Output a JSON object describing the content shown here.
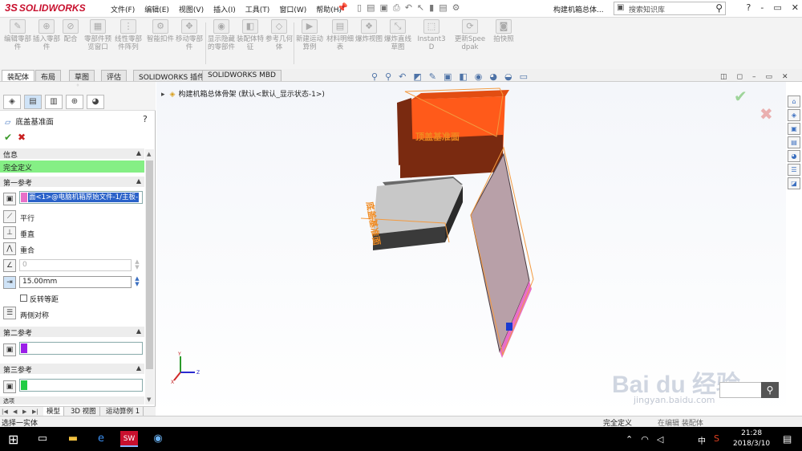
{
  "app": {
    "logo_ds": "3S",
    "logo_text": "SOLIDWORKS",
    "document_title": "构建机箱总体...",
    "search_placeholder": "搜索知识库"
  },
  "menu": [
    "文件(F)",
    "编辑(E)",
    "视图(V)",
    "插入(I)",
    "工具(T)",
    "窗口(W)",
    "帮助(H)"
  ],
  "window_controls": [
    "?",
    "-",
    "▭",
    "✕"
  ],
  "commands": [
    {
      "label": "编辑零部件"
    },
    {
      "label": "插入零部件"
    },
    {
      "label": "配合"
    },
    {
      "label": "零部件预览窗口"
    },
    {
      "label": "线性零部件阵列"
    },
    {
      "label": "智能扣件"
    },
    {
      "label": "移动零部件"
    },
    {
      "label": "显示隐藏的零部件"
    },
    {
      "label": "装配体特征"
    },
    {
      "label": "参考几何体"
    },
    {
      "label": "新建运动算例"
    },
    {
      "label": "材料明细表"
    },
    {
      "label": "爆炸视图"
    },
    {
      "label": "爆炸直线草图"
    },
    {
      "label": "Instant3D"
    },
    {
      "label": "更新Speedpak"
    },
    {
      "label": "拍快照"
    }
  ],
  "tabs": [
    "装配体",
    "布局",
    "草图",
    "评估",
    "SOLIDWORKS 插件",
    "SOLIDWORKS MBD"
  ],
  "property_manager": {
    "title": "底盖基准面",
    "help": "?",
    "sections": {
      "info": "信息",
      "status": "完全定义",
      "first_ref": "第一参考",
      "second_ref": "第二参考",
      "third_ref": "第三参考",
      "more": "选项"
    },
    "first_ref_value": "面<1>@电脑机箱原始文件-1/主板-",
    "options": {
      "parallel": "平行",
      "perpendicular": "垂直",
      "coincident": "重合",
      "angle_value": "0",
      "distance_value": "15.00mm",
      "flip": "反转等距",
      "symmetric": "两侧对称"
    },
    "ref_colors": {
      "first": "#e86fc8",
      "second": "#9b1fe8",
      "third": "#22cc44"
    }
  },
  "bottom_tabs": [
    "模型",
    "3D 视图",
    "运动算例 1"
  ],
  "viewport": {
    "tree_root": "构建机箱总体骨架 (默认<默认_显示状态-1>)",
    "label_top_box": "顶盖基准面",
    "label_side": "底盖基准面",
    "axis_x": "X",
    "axis_y": "Y",
    "axis_z": "Z",
    "watermark": "Bai du 经验",
    "watermark_sub": "jingyan.baidu.com"
  },
  "statusbar": {
    "left": "选择一实体",
    "right": "完全定义",
    "extra": "在编辑 装配体"
  },
  "taskbar": {
    "ime": "中",
    "time": "21:28",
    "date": "2018/3/10"
  },
  "colors": {
    "brand": "#c8102e",
    "status_ok": "#85ef85",
    "box_orange": "#ff5a1a",
    "box_dark": "#7a2a10",
    "plate": "#b8a0a8"
  }
}
